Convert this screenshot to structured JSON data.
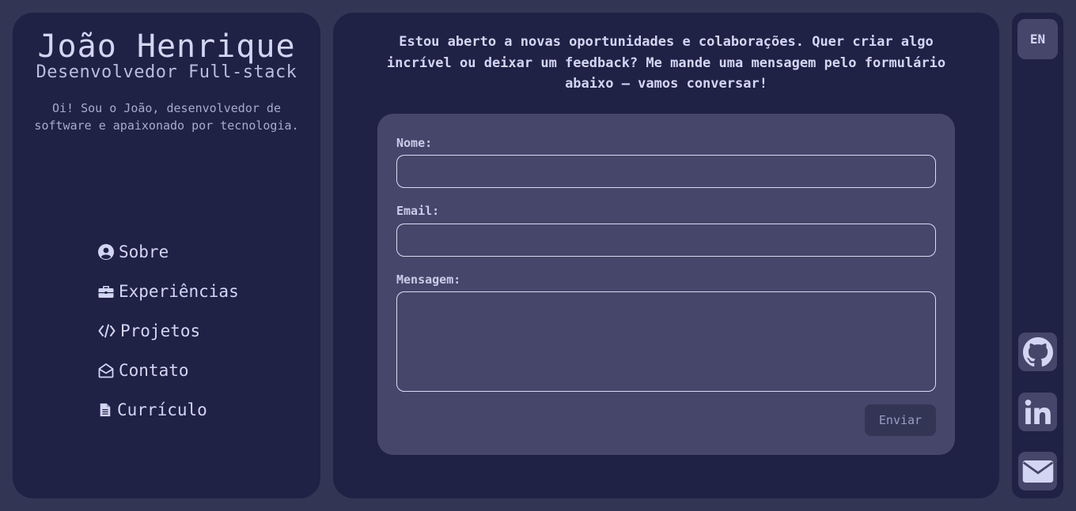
{
  "profile": {
    "name": "João Henrique",
    "role": "Desenvolvedor Full-stack",
    "bio": "Oi! Sou o João, desenvolvedor de software e apaixonado por tecnologia."
  },
  "nav": {
    "items": [
      {
        "label": "Sobre",
        "icon": "user-circle-icon"
      },
      {
        "label": "Experiências",
        "icon": "briefcase-icon"
      },
      {
        "label": "Projetos",
        "icon": "code-icon"
      },
      {
        "label": "Contato",
        "icon": "envelope-open-icon"
      },
      {
        "label": "Currículo",
        "icon": "file-icon"
      }
    ]
  },
  "contact": {
    "intro": "Estou aberto a novas oportunidades e colaborações. Quer criar algo incrível ou deixar um feedback? Me mande uma mensagem pelo formulário abaixo — vamos conversar!",
    "name_label": "Nome:",
    "name_value": "",
    "email_label": "Email:",
    "email_value": "",
    "message_label": "Mensagem:",
    "message_value": "",
    "submit_label": "Enviar"
  },
  "sidebar": {
    "language": "EN",
    "social": [
      "github-icon",
      "linkedin-icon",
      "email-icon"
    ]
  },
  "colors": {
    "background": "#333555",
    "panel": "#1f2145",
    "card": "#45466a",
    "text": "#d3d6f2"
  }
}
